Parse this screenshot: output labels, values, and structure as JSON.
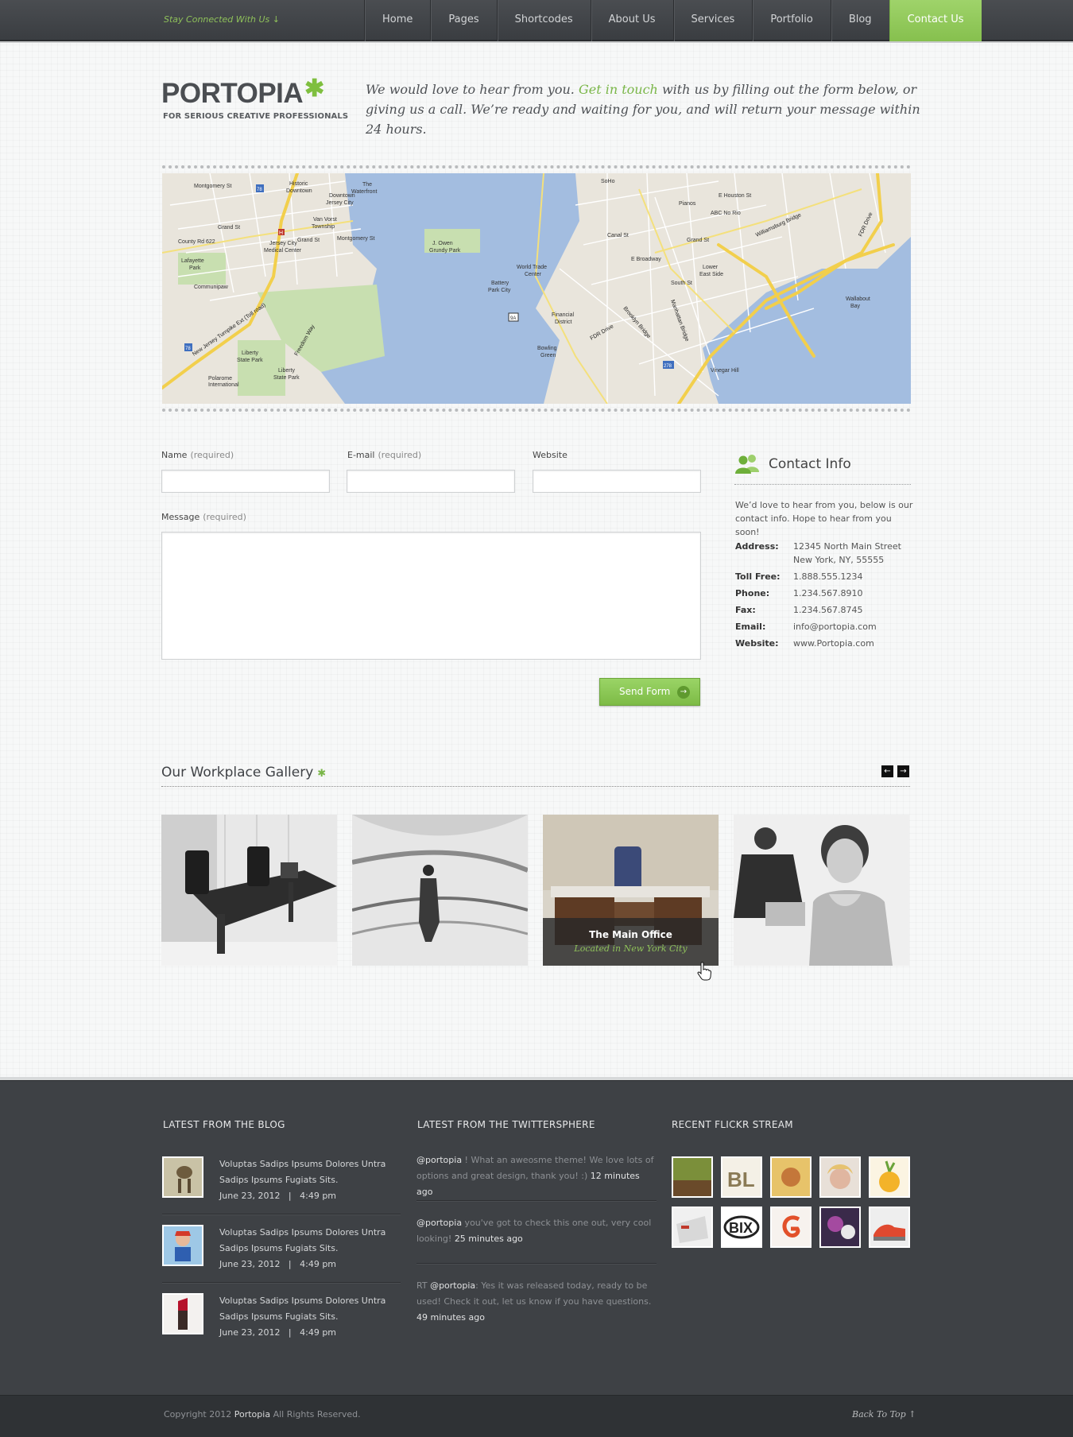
{
  "topbar": {
    "stay_connected": "Stay Connected With Us ↓",
    "nav": [
      "Home",
      "Pages",
      "Shortcodes",
      "About Us",
      "Services",
      "Portfolio",
      "Blog",
      "Contact Us"
    ],
    "active": "Contact Us"
  },
  "header": {
    "logo": "PORTOPIA",
    "logo_star": "✱",
    "tagline": "FOR SERIOUS CREATIVE PROFESSIONALS",
    "intro_a": "We would love to hear from you.",
    "intro_link": "Get in touch",
    "intro_b": "with us by filling out the form below, or giving us a call. We’re ready and waiting for you, and will return your message within 24 hours."
  },
  "map": {
    "labels": [
      "Historic Downtown",
      "Downtown Jersey City",
      "The Waterfront",
      "Van Vorst Township",
      "Jersey City Medical Center",
      "Lafayette Park",
      "Communipaw",
      "Liberty State Park",
      "J. Owen Grundy Park",
      "World Trade Center",
      "Battery Park City",
      "Financial District",
      "Bowling Green",
      "SoHo",
      "Lower East Side",
      "Wallabout Bay",
      "Vinegar Hill",
      "ABC No Rio",
      "Pianos",
      "Williamsburg Bridge",
      "Manhattan Bridge",
      "Brooklyn Bridge",
      "FDR Drive",
      "E Houston St",
      "Grand St",
      "Montgomery St",
      "County Rd 622",
      "New Jersey Turnpike Ext (Toll road)",
      "South St",
      "E Broadway",
      "Canal St",
      "Polarome International",
      "Freedom Way"
    ],
    "route_badges": [
      "78",
      "78",
      "9A",
      "278"
    ]
  },
  "form": {
    "name_label": "Name",
    "email_label": "E-mail",
    "website_label": "Website",
    "message_label": "Message",
    "required": "(required)",
    "send": "Send Form",
    "send_icon": "→"
  },
  "contact": {
    "title": "Contact Info",
    "text": "We’d love to hear from you, below is our contact info. Hope to hear from you soon!",
    "rows": [
      {
        "k": "Address:",
        "v": "12345 North Main Street New York, NY, 55555"
      },
      {
        "k": "Toll Free:",
        "v": "1.888.555.1234"
      },
      {
        "k": "Phone:",
        "v": "1.234.567.8910"
      },
      {
        "k": "Fax:",
        "v": "1.234.567.8745"
      },
      {
        "k": "Email:",
        "v": "info@portopia.com"
      },
      {
        "k": "Website:",
        "v": "www.Portopia.com"
      }
    ]
  },
  "gallery": {
    "title": "Our Workplace Gallery",
    "star": "✱",
    "prev": "←",
    "next": "→",
    "caption_title": "The Main Office",
    "caption_sub": "Located in New York City"
  },
  "footer": {
    "blog_heading": "LATEST FROM THE BLOG",
    "twitter_heading": "LATEST FROM THE TWITTERSPHERE",
    "flickr_heading": "RECENT FLICKR STREAM",
    "posts": [
      {
        "title": "Voluptas Sadips Ipsums Dolores Untra Sadips Ipsums Fugiats Sits.",
        "meta": "June 23, 2012   |   4:49 pm"
      },
      {
        "title": "Voluptas Sadips Ipsums Dolores Untra Sadips Ipsums Fugiats Sits.",
        "meta": "June 23, 2012   |   4:49 pm"
      },
      {
        "title": "Voluptas Sadips Ipsums Dolores Untra Sadips Ipsums Fugiats Sits.",
        "meta": "June 23, 2012   |   4:49 pm"
      }
    ],
    "tweets": [
      {
        "pre": "",
        "user": "@portopia",
        "text": " ! What an aweosme theme!  We love lots of options and great design, thank you!  :) ",
        "ago": "12 minutes ago"
      },
      {
        "pre": "",
        "user": "@portopia",
        "text": " you've got to check this one out, very cool looking! ",
        "ago": "25 minutes ago"
      },
      {
        "pre": "RT ",
        "user": "@portopia",
        "text": ": Yes it was released today, ready to be used! Check it out, let us know if you have questions. ",
        "ago": "49 minutes ago"
      }
    ],
    "copyright_pre": "Copyright 2012",
    "copyright_brand": "Portopia",
    "copyright_post": "All Rights Reserved.",
    "back_to_top": "Back To Top  ↑"
  },
  "colors": {
    "accent": "#86c04e",
    "topbar": "#3e4145",
    "footer": "#3e4145"
  }
}
